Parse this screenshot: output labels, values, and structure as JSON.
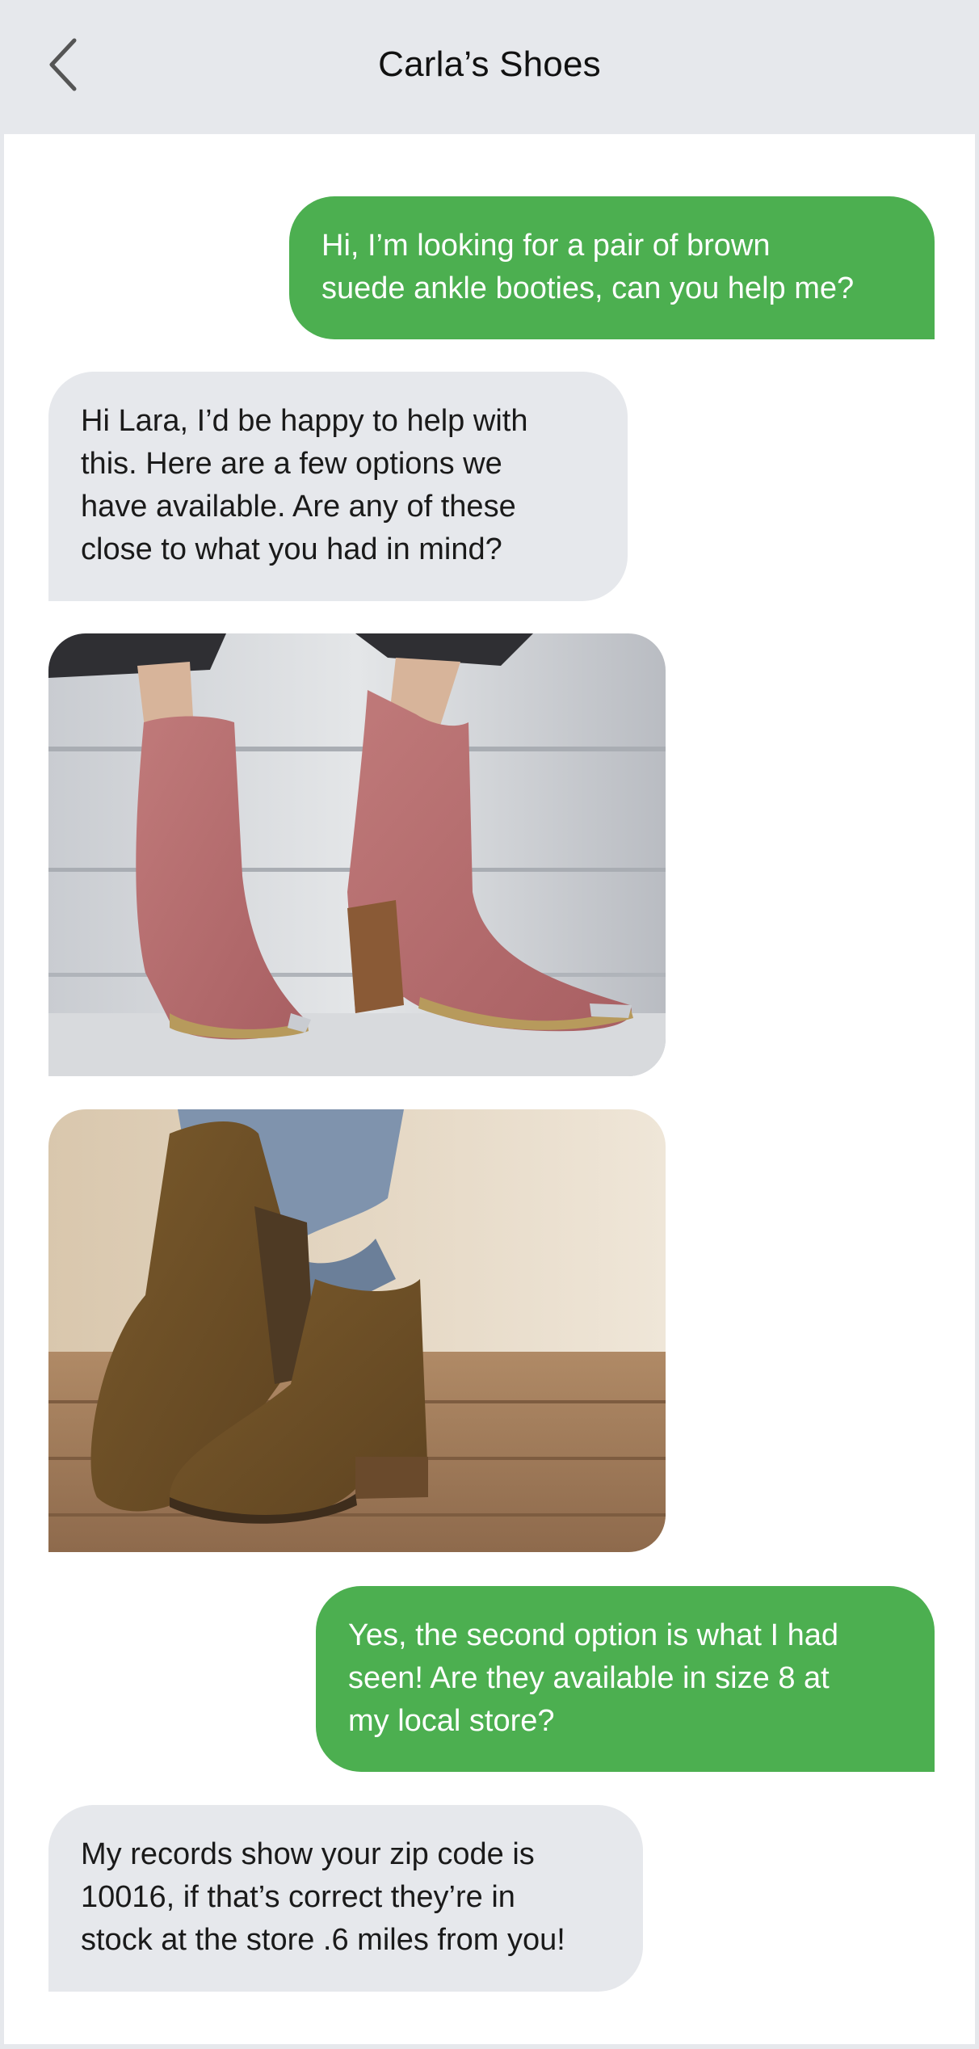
{
  "header": {
    "title": "Carla’s Shoes",
    "back_icon": "chevron-left-icon"
  },
  "colors": {
    "header_bg": "#e6e8ec",
    "sent_bubble": "#4caf50",
    "received_bubble": "#e6e8ec",
    "chat_bg": "#ffffff"
  },
  "messages": [
    {
      "sender": "user",
      "lines": [
        "Hi, I’m looking for a pair of brown",
        "suede ankle booties, can you help me?"
      ]
    },
    {
      "sender": "store",
      "lines": [
        "Hi Lara, I’d be happy to help with",
        "this. Here are a few options we",
        "have available. Are any of these",
        "close to what you had in mind?"
      ]
    },
    {
      "sender": "store",
      "image": "pink-suede-ankle-booties-photo"
    },
    {
      "sender": "store",
      "image": "brown-suede-ankle-booties-photo"
    },
    {
      "sender": "user",
      "lines": [
        "Yes, the second option is what I had",
        "seen! Are they available in size 8 at",
        "my local store?"
      ]
    },
    {
      "sender": "store",
      "lines": [
        "My records show your zip code is",
        "10016, if that’s correct they’re in",
        "stock at the store .6 miles from you!"
      ]
    }
  ]
}
